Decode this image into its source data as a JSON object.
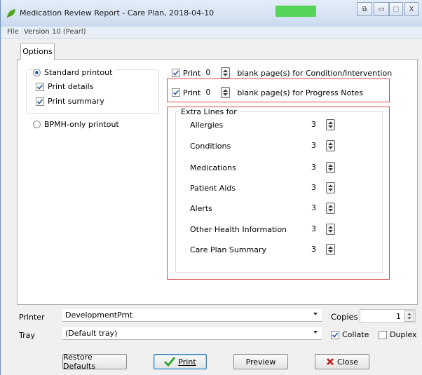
{
  "window": {
    "title": "Medication Review Report - Care Plan, 2018-04-10",
    "controls": {
      "restore": "⧉",
      "minimize": "▭",
      "maximize": "▢",
      "close": "X"
    }
  },
  "menubar": {
    "file": "File",
    "version": "Version 10 (Pearl)"
  },
  "tabs": [
    {
      "label": "Options",
      "active": true
    }
  ],
  "print_mode": {
    "standard_label": "Standard printout",
    "standard_selected": true,
    "print_details_label": "Print details",
    "print_details_checked": true,
    "print_summary_label": "Print summary",
    "print_summary_checked": true,
    "bpmh_label": "BPMH-only printout",
    "bpmh_selected": false
  },
  "blank_pages": [
    {
      "print_label": "Print",
      "value": "0",
      "checked": true,
      "suffix": "blank page(s) for Condition/Intervention"
    },
    {
      "print_label": "Print",
      "value": "0",
      "checked": true,
      "suffix": "blank page(s) for Progress Notes"
    }
  ],
  "extra_lines": {
    "legend": "Extra Lines for",
    "items": [
      {
        "label": "Allergies",
        "value": "3"
      },
      {
        "label": "Conditions",
        "value": "3"
      },
      {
        "label": "Medications",
        "value": "3"
      },
      {
        "label": "Patient Aids",
        "value": "3"
      },
      {
        "label": "Alerts",
        "value": "3"
      },
      {
        "label": "Other Health Information",
        "value": "3"
      },
      {
        "label": "Care Plan Summary",
        "value": "3"
      }
    ]
  },
  "printer": {
    "label": "Printer",
    "value": "DevelopmentPrnt"
  },
  "tray": {
    "label": "Tray",
    "value": "(Default tray)"
  },
  "copies": {
    "label": "Copies",
    "value": "1"
  },
  "collate": {
    "label": "Collate",
    "checked": true
  },
  "duplex": {
    "label": "Duplex",
    "checked": false
  },
  "buttons": {
    "restore_defaults": "Restore Defaults",
    "print": "Print",
    "preview": "Preview",
    "close": "Close"
  },
  "colors": {
    "accent_red": "#d8484a",
    "check_green": "#1e9e1e",
    "close_red": "#c01818"
  }
}
